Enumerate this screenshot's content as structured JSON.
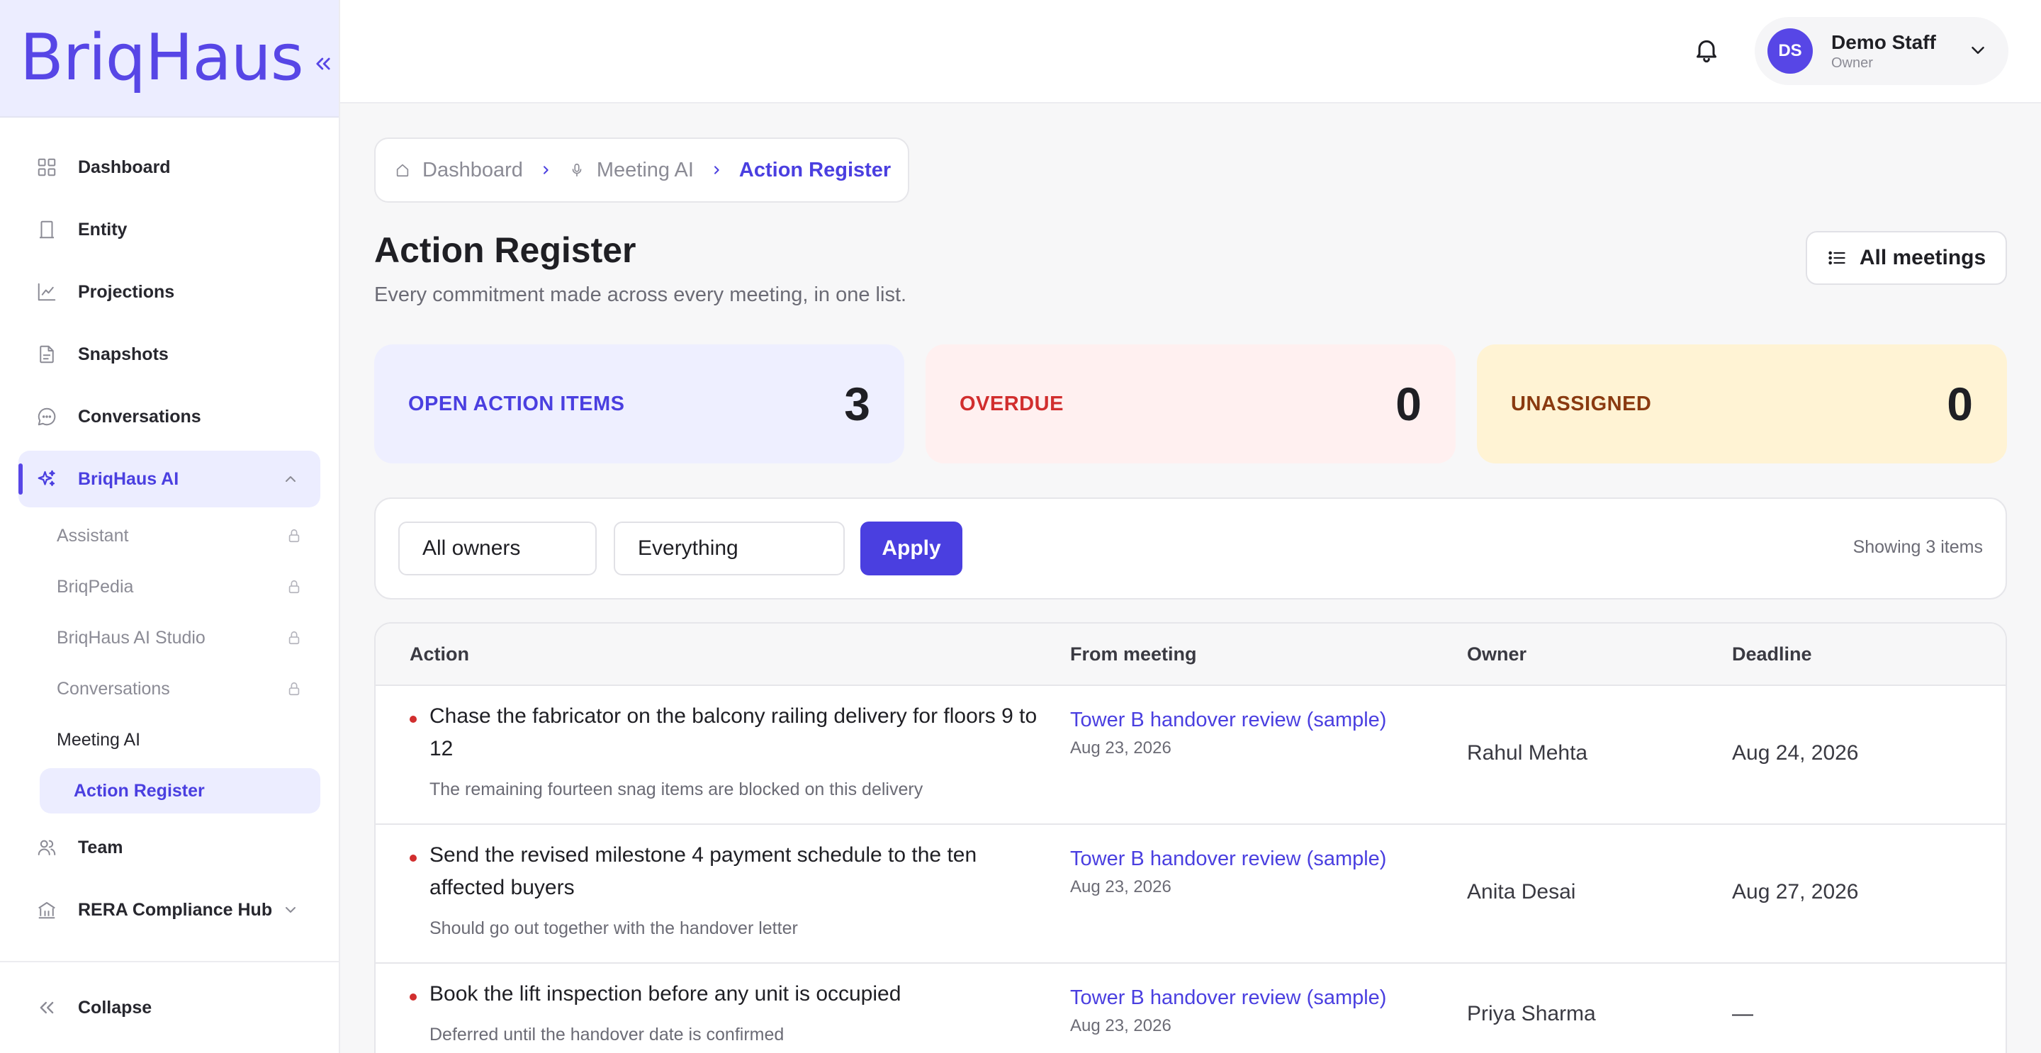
{
  "app": {
    "brand": "BriqHaus"
  },
  "sidebar": {
    "items": [
      {
        "label": "Dashboard",
        "icon": "grid-icon"
      },
      {
        "label": "Entity",
        "icon": "building-icon"
      },
      {
        "label": "Projections",
        "icon": "line-chart-icon"
      },
      {
        "label": "Snapshots",
        "icon": "document-icon"
      },
      {
        "label": "Conversations",
        "icon": "chat-icon"
      },
      {
        "label": "BriqHaus AI",
        "icon": "sparkles-icon"
      },
      {
        "label": "Team",
        "icon": "users-icon"
      },
      {
        "label": "RERA Compliance Hub",
        "icon": "bank-icon"
      }
    ],
    "ai_subitems": [
      {
        "label": "Assistant",
        "locked": true
      },
      {
        "label": "BriqPedia",
        "locked": true
      },
      {
        "label": "BriqHaus AI Studio",
        "locked": true
      },
      {
        "label": "Conversations",
        "locked": true
      },
      {
        "label": "Meeting AI",
        "locked": false
      },
      {
        "label": "Action Register",
        "locked": false
      }
    ],
    "collapse_label": "Collapse"
  },
  "topbar": {
    "user_initials": "DS",
    "user_name": "Demo Staff",
    "user_role": "Owner"
  },
  "breadcrumb": {
    "items": [
      "Dashboard",
      "Meeting AI",
      "Action Register"
    ]
  },
  "page": {
    "title": "Action Register",
    "subtitle": "Every commitment made across every meeting, in one list.",
    "all_meetings_label": "All meetings"
  },
  "stats": [
    {
      "label": "OPEN ACTION ITEMS",
      "value": "3",
      "color": "#4a3fe0"
    },
    {
      "label": "OVERDUE",
      "value": "0",
      "color": "#d12e2e"
    },
    {
      "label": "UNASSIGNED",
      "value": "0",
      "color": "#8a3a10"
    }
  ],
  "filters": {
    "owner_value": "All owners",
    "scope_value": "Everything",
    "apply_label": "Apply",
    "showing_text": "Showing 3 items"
  },
  "table": {
    "headers": [
      "Action",
      "From meeting",
      "Owner",
      "Deadline"
    ],
    "rows": [
      {
        "title": "Chase the fabricator on the balcony railing delivery for floors 9 to 12",
        "note": "The remaining fourteen snag items are blocked on this delivery",
        "meeting": "Tower B handover review (sample)",
        "meeting_date": "Aug 23, 2026",
        "owner": "Rahul Mehta",
        "deadline": "Aug 24, 2026"
      },
      {
        "title": "Send the revised milestone 4 payment schedule to the ten affected buyers",
        "note": "Should go out together with the handover letter",
        "meeting": "Tower B handover review (sample)",
        "meeting_date": "Aug 23, 2026",
        "owner": "Anita Desai",
        "deadline": "Aug 27, 2026"
      },
      {
        "title": "Book the lift inspection before any unit is occupied",
        "note": "Deferred until the handover date is confirmed",
        "meeting": "Tower B handover review (sample)",
        "meeting_date": "Aug 23, 2026",
        "owner": "Priya Sharma",
        "deadline": "—"
      }
    ]
  },
  "colors": {
    "accent": "#4a3fe0",
    "brand": "#5746e6",
    "danger": "#d12e2e"
  }
}
